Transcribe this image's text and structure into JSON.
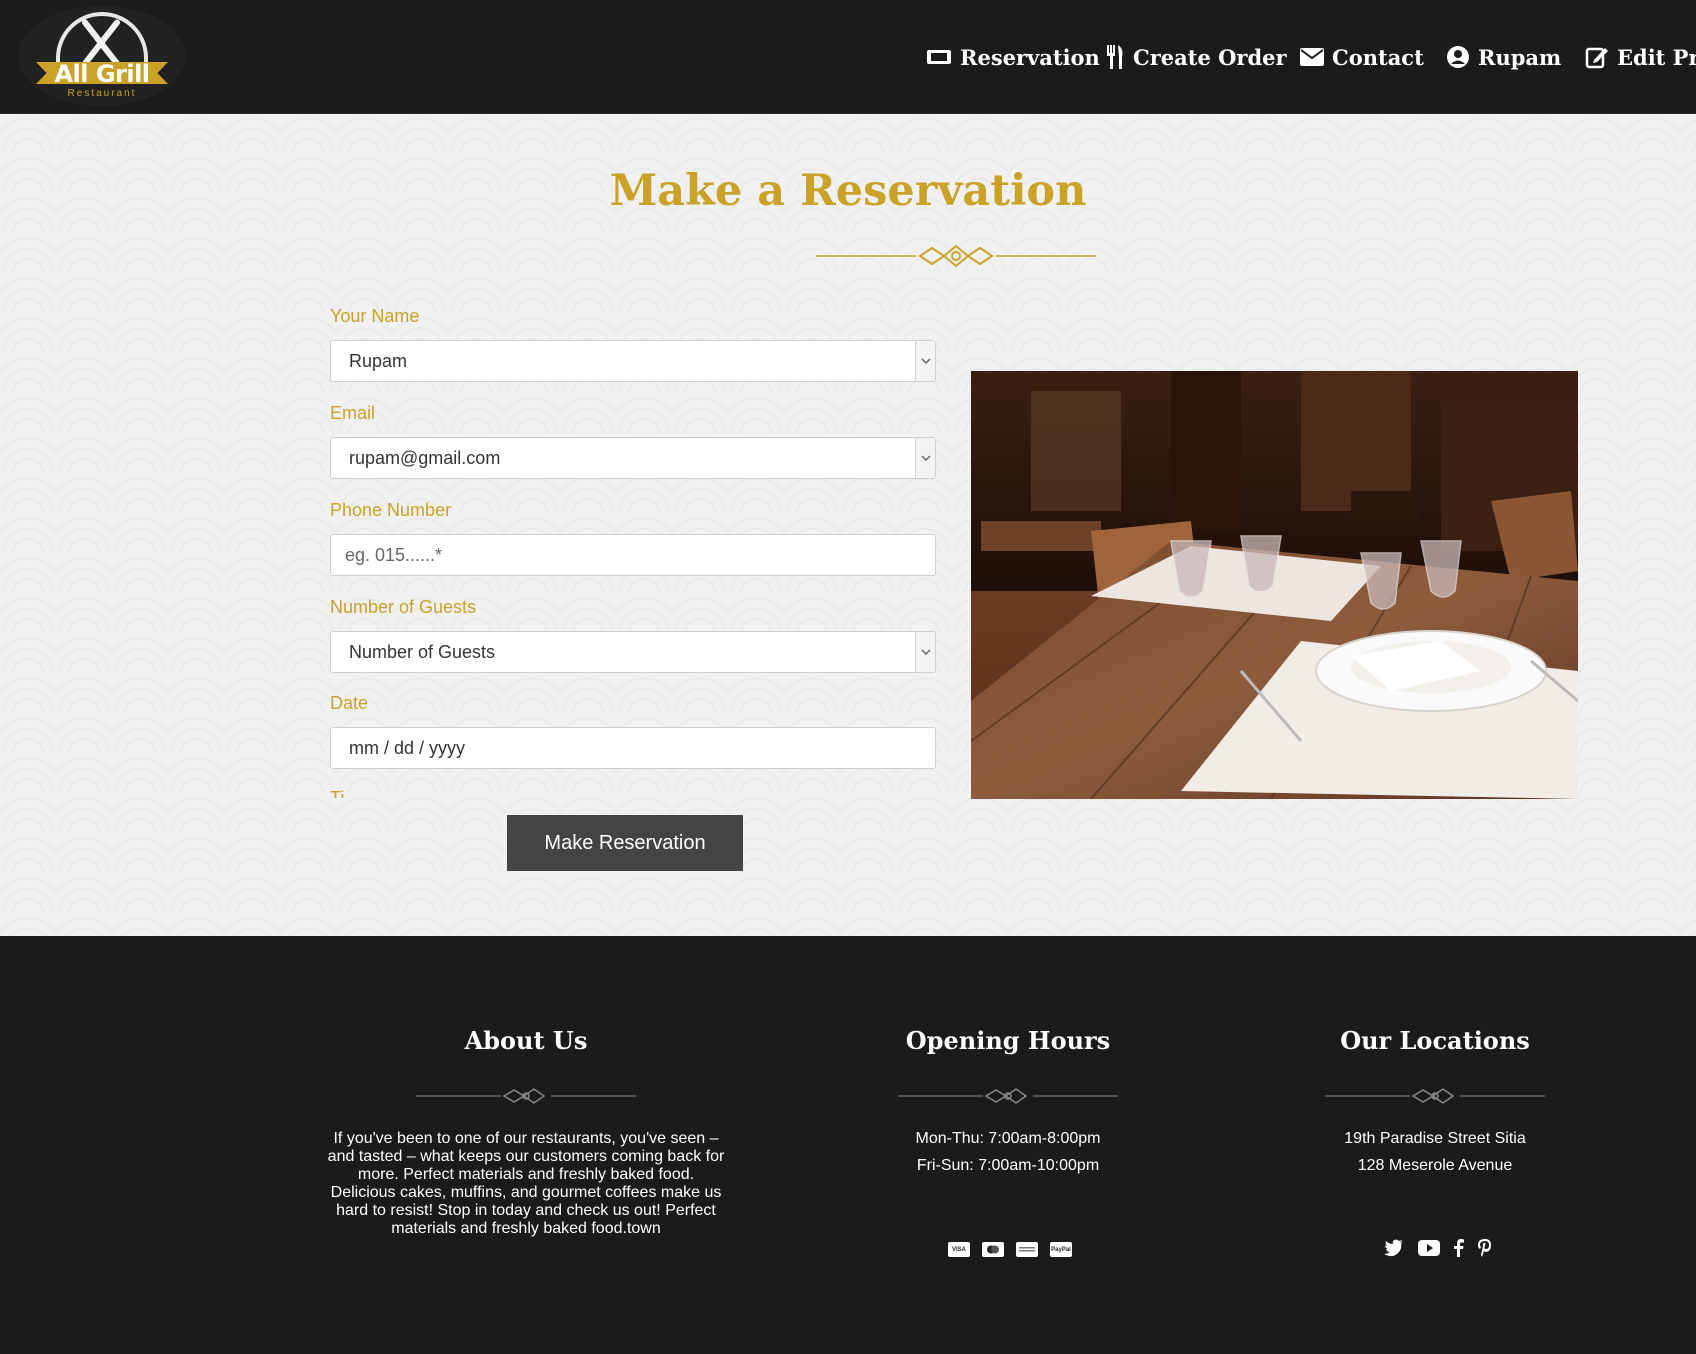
{
  "header": {
    "logo_text": "All Grill",
    "logo_sub": "Restaurant",
    "nav": [
      {
        "label": "Reservation",
        "icon": "ticket-icon"
      },
      {
        "label": "Create Order",
        "icon": "utensils-icon"
      },
      {
        "label": "Contact",
        "icon": "envelope-icon"
      },
      {
        "label": "Rupam",
        "icon": "user-circle-icon"
      },
      {
        "label": "Edit Prof",
        "icon": "edit-icon"
      }
    ]
  },
  "reservation": {
    "title": "Make a Reservation",
    "fields": {
      "name": {
        "label": "Your Name",
        "value": "Rupam"
      },
      "email": {
        "label": "Email",
        "value": "rupam@gmail.com"
      },
      "phone": {
        "label": "Phone Number",
        "placeholder": "eg. 015......*"
      },
      "guests": {
        "label": "Number of Guests",
        "value": "Number of Guests"
      },
      "date": {
        "label": "Date",
        "placeholder": "mm / dd / yyyy"
      },
      "time": {
        "label": "Ti"
      }
    },
    "submit_label": "Make Reservation"
  },
  "footer": {
    "about": {
      "title": "About Us",
      "text": "If you've been to one of our restaurants, you've seen – and tasted – what keeps our customers coming back for more. Perfect materials and freshly baked food. Delicious cakes, muffins, and gourmet coffees make us hard to resist! Stop in today and check us out! Perfect materials and freshly baked food.town"
    },
    "hours": {
      "title": "Opening Hours",
      "line1": "Mon-Thu: 7:00am-8:00pm",
      "line2": "Fri-Sun: 7:00am-10:00pm",
      "payments": [
        "VISA",
        "MC",
        "AMEX",
        "PayPal"
      ]
    },
    "locations": {
      "title": "Our Locations",
      "line1": "19th Paradise Street Sitia",
      "line2": "128 Meserole Avenue",
      "social": [
        "twitter-icon",
        "youtube-icon",
        "facebook-icon",
        "pinterest-icon"
      ]
    }
  },
  "colors": {
    "accent": "#c9a227",
    "dark": "#1b1b1b",
    "button": "#444444"
  }
}
